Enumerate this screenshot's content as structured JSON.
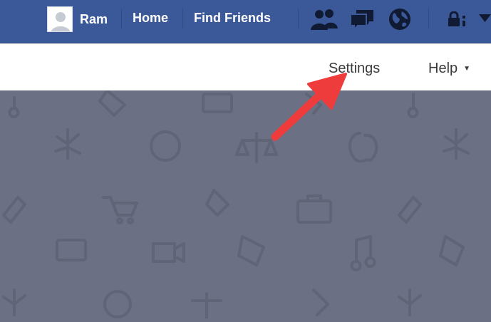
{
  "header": {
    "user_name": "Ram",
    "nav": {
      "home_label": "Home",
      "find_friends_label": "Find Friends"
    },
    "icons": [
      "friend-requests-icon",
      "messages-icon",
      "notifications-globe-icon",
      "privacy-lock-icon",
      "account-menu-caret-icon"
    ]
  },
  "subnav": {
    "settings_label": "Settings",
    "help_label": "Help",
    "help_caret": "▼"
  },
  "colors": {
    "brand_blue": "#3b5998",
    "background": "#6b7084",
    "arrow_red": "#ee3b3b"
  }
}
